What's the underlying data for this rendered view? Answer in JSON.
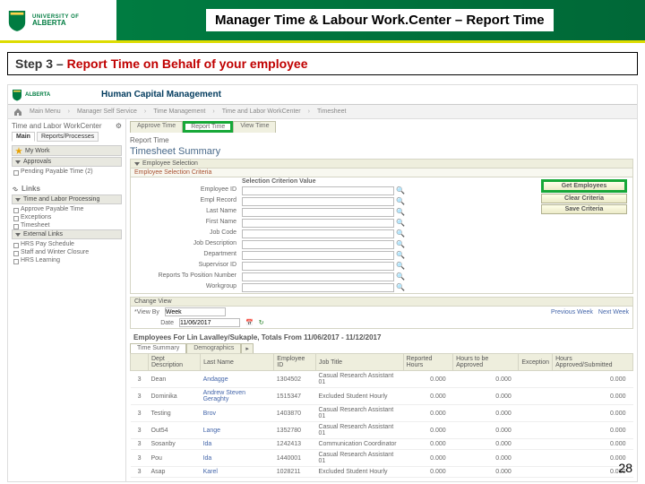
{
  "logo": {
    "uni_of": "UNIVERSITY OF",
    "name": "ALBERTA"
  },
  "slide_title": "Manager Time & Labour Work.Center – Report Time",
  "step_label": "Step 3 – ",
  "step_red": "Report Time on Behalf of your employee",
  "hcm_title": "Human Capital Management",
  "breadcrumb": [
    "Main Menu",
    "Manager Self Service",
    "Time Management",
    "Time and Labor WorkCenter",
    "Timesheet"
  ],
  "left": {
    "wc_title": "Time and Labor WorkCenter",
    "tabs": [
      "Main",
      "Reports/Processes"
    ],
    "mywork": "My Work",
    "approvals": "Approvals",
    "pending": "Pending Payable Time (2)",
    "links": "Links",
    "sec1": "Time and Labor Processing",
    "s1i1": "Approve Payable Time",
    "s1i2": "Exceptions",
    "s1i3": "Timesheet",
    "sec2": "External Links",
    "s2i1": "HRS Pay Schedule",
    "s2i2": "Staff and Winter Closure",
    "s2i3": "HRS Learning"
  },
  "right": {
    "tabs": [
      "Approve Time",
      "Report Time",
      "View Time"
    ],
    "page_h": "Report Time",
    "ts": "Timesheet Summary",
    "emp_sel": "Employee Selection",
    "emp_sel_crit": "Employee Selection Criteria",
    "crit_label": "Selection Criterion Value",
    "fields": [
      "Employee ID",
      "Empl Record",
      "Last Name",
      "First Name",
      "Job Code",
      "Job Description",
      "Department",
      "Supervisor ID",
      "Reports To Position Number",
      "Workgroup"
    ],
    "btn_get": "Get Employees",
    "btn_clear": "Clear Criteria",
    "btn_save": "Save Criteria",
    "cv": "Change View",
    "viewby_lbl": "*View By",
    "viewby_val": "Week",
    "date_lbl": "Date",
    "date_val": "11/06/2017",
    "prev": "Previous Week",
    "next": "Next Week",
    "emp_totals": "Employees For Lin Lavalley/Sukaple, Totals From 11/06/2017 - 11/12/2017",
    "ttabs": [
      "Time Summary",
      "Demographics"
    ],
    "thead": [
      "",
      "Dept Description",
      "Last Name",
      "Employee ID",
      "Job Title",
      "Reported Hours",
      "Hours to be Approved",
      "Exception",
      "Hours Approved/Submitted"
    ],
    "rows": [
      {
        "n": "3",
        "dept": "Dean",
        "ln": "Andagge",
        "id": "1304502",
        "jt": "Casual Research Assistant 01",
        "rh": "0.000",
        "tb": "0.000",
        "ex": "",
        "ha": "0.000"
      },
      {
        "n": "3",
        "dept": "Dominika",
        "ln": "Andrew Steven Geraghty",
        "id": "1515347",
        "jt": "Excluded Student Hourly",
        "rh": "0.000",
        "tb": "0.000",
        "ex": "",
        "ha": "0.000"
      },
      {
        "n": "3",
        "dept": "Testing",
        "ln": "Brov",
        "id": "1403870",
        "jt": "Casual Research Assistant 01",
        "rh": "0.000",
        "tb": "0.000",
        "ex": "",
        "ha": "0.000"
      },
      {
        "n": "3",
        "dept": "Out54",
        "ln": "Lange",
        "id": "1352780",
        "jt": "Casual Research Assistant 01",
        "rh": "0.000",
        "tb": "0.000",
        "ex": "",
        "ha": "0.000"
      },
      {
        "n": "3",
        "dept": "Sosanby",
        "ln": "Ida",
        "id": "1242413",
        "jt": "Communication Coordinator",
        "rh": "0.000",
        "tb": "0.000",
        "ex": "",
        "ha": "0.000"
      },
      {
        "n": "3",
        "dept": "Pou",
        "ln": "Ida",
        "id": "1440001",
        "jt": "Casual Research Assistant 01",
        "rh": "0.000",
        "tb": "0.000",
        "ex": "",
        "ha": "0.000"
      },
      {
        "n": "3",
        "dept": "Asap",
        "ln": "Karel",
        "id": "1028211",
        "jt": "Excluded Student Hourly",
        "rh": "0.000",
        "tb": "0.000",
        "ex": "",
        "ha": "0.000"
      }
    ]
  },
  "page_num": "28"
}
